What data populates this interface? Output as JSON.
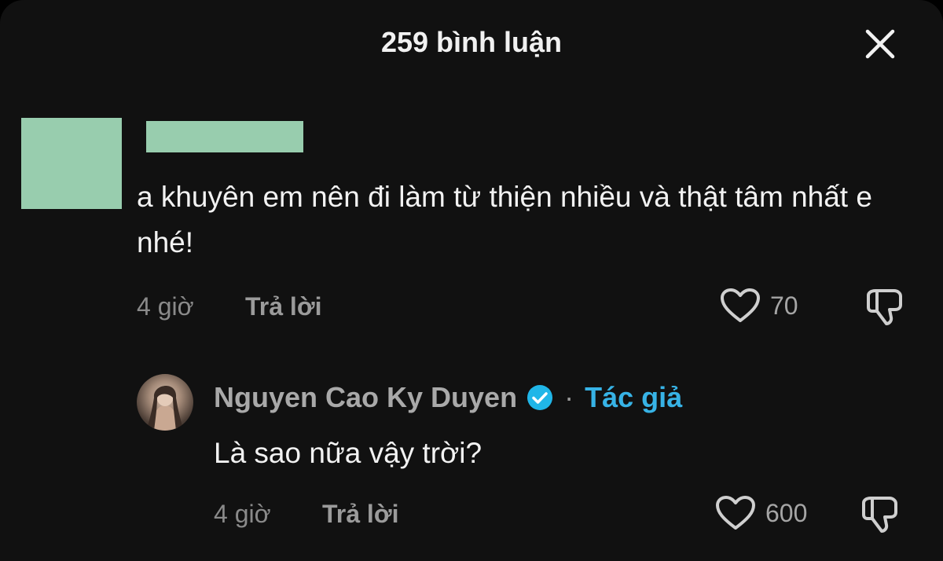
{
  "header": {
    "title": "259 bình luận",
    "close_icon": "close-icon"
  },
  "comments": [
    {
      "username": "",
      "text": "a khuyên em nên đi làm từ thiện nhiều và thật tâm nhất e nhé!",
      "time": "4 giờ",
      "reply_label": "Trả lời",
      "likes": "70",
      "redacted_color": "#98cdae"
    },
    {
      "username": "Nguyen Cao Ky Duyen",
      "verified": true,
      "separator": "·",
      "author_tag": "Tác giả",
      "text": "Là sao nữa vậy trời?",
      "time": "4 giờ",
      "reply_label": "Trả lời",
      "likes": "600",
      "tag_color": "#37b3e6"
    }
  ]
}
